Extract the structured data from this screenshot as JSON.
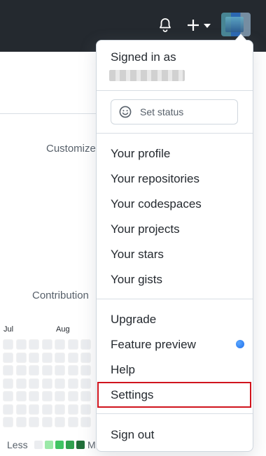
{
  "header": {
    "bell_icon": "bell-icon",
    "create_icon": "plus-icon",
    "dropdown_icon": "caret-down-icon"
  },
  "background": {
    "customize_label": "Customize",
    "contributions_label": "Contribution",
    "months": [
      "Jul",
      "Aug"
    ],
    "legend": {
      "less": "Less",
      "more": "M"
    },
    "legend_colors": [
      "#ebedf0",
      "#9be9a8",
      "#40c463",
      "#30a14e",
      "#216e39"
    ]
  },
  "menu": {
    "signed_in_as": "Signed in as",
    "set_status": "Set status",
    "items_group1": [
      "Your profile",
      "Your repositories",
      "Your codespaces",
      "Your projects",
      "Your stars",
      "Your gists"
    ],
    "items_group2": [
      "Upgrade",
      "Feature preview",
      "Help",
      "Settings"
    ],
    "sign_out": "Sign out",
    "highlight_color": "#d0141d",
    "preview_dot_color": "#1f6feb"
  }
}
